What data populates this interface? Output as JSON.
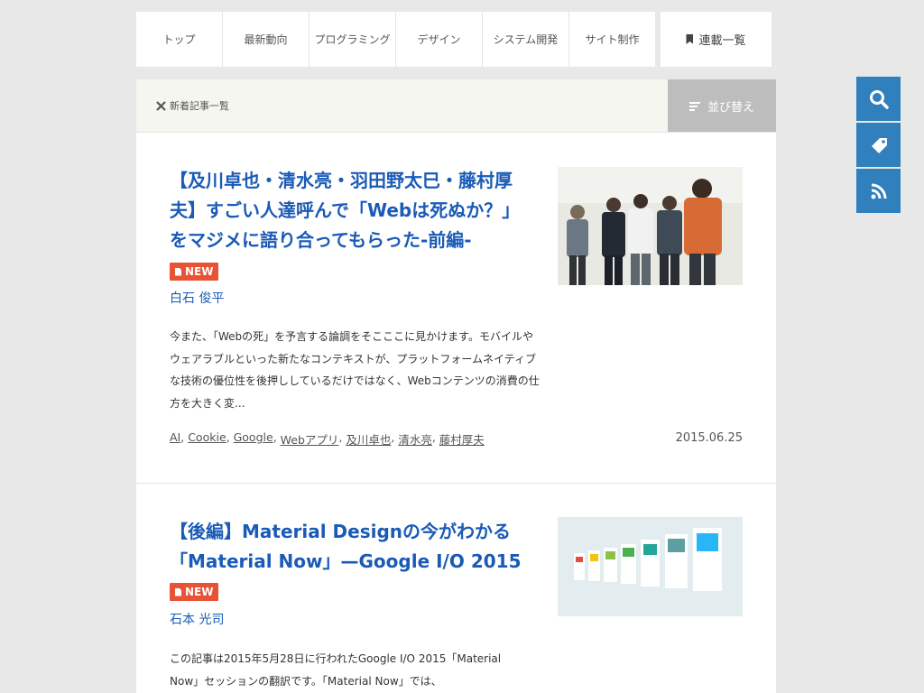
{
  "nav": {
    "items": [
      "トップ",
      "最新動向",
      "プログラミング",
      "デザイン",
      "システム開発",
      "サイト制作"
    ],
    "series_label": "連載一覧"
  },
  "side_buttons": [
    "search-icon",
    "tag-icon",
    "rss-icon"
  ],
  "list_header": {
    "title": "新着記事一覧",
    "sort_label": "並び替え"
  },
  "articles": [
    {
      "title": "【及川卓也・清水亮・羽田野太巳・藤村厚夫】すごい人達呼んで「Webは死ぬか？」をマジメに語り合ってもらった-前編-",
      "badge": "NEW",
      "author": "白石 俊平",
      "excerpt": "今また、「Webの死」を予言する論調をそこここに見かけます。モバイルやウェアラブルといった新たなコンテキストが、プラットフォームネイティブな技術の優位性を後押ししているだけではなく、Webコンテンツの消費の仕方を大きく変...",
      "tags": [
        "AI",
        "Cookie",
        "Google",
        "Webアプリ",
        "及川卓也",
        "清水亮",
        "藤村厚夫"
      ],
      "date": "2015.06.25"
    },
    {
      "title": "【後編】Material Designの今がわかる「Material Now」—Google I/O 2015",
      "badge": "NEW",
      "author": "石本 光司",
      "excerpt": "この記事は2015年5月28日に行われたGoogle I/O 2015「Material Now」セッションの翻訳です。「Material Now」では、"
    }
  ]
}
